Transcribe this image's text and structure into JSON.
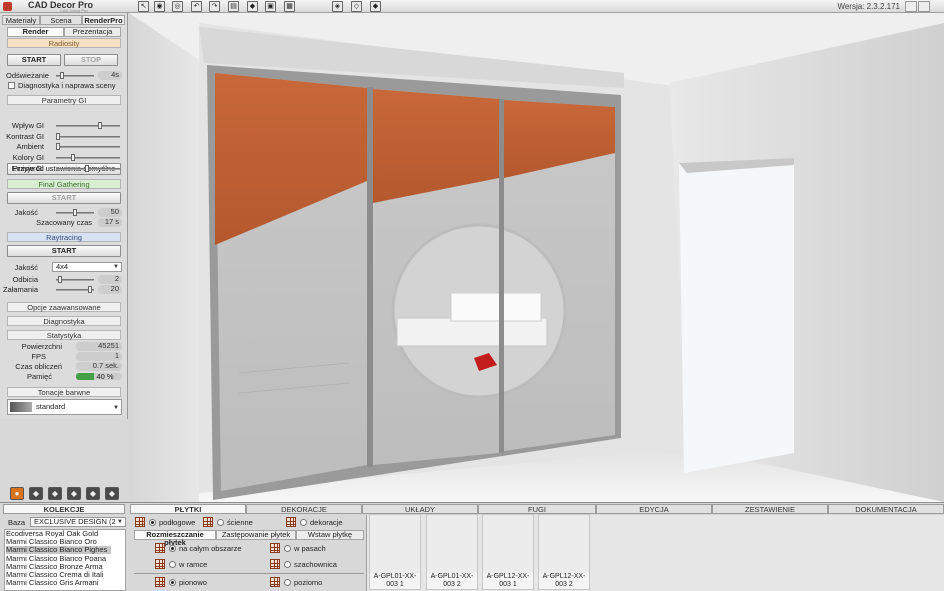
{
  "app": {
    "title": "CAD Decor Pro",
    "subtitle": "CAD Decor Pro",
    "version": "Wersja: 2.3.2.171"
  },
  "left_tabs": [
    "Materiały",
    "Scena",
    "RenderPro"
  ],
  "render_tabs": [
    "Render",
    "Prezentacja"
  ],
  "radiosity": {
    "header": "Radiosity",
    "start": "START",
    "stop": "STOP",
    "refresh_label": "Odświeżanie",
    "refresh_value": "4s",
    "diagnostics": "Diagnostyka i naprawa sceny"
  },
  "gi": {
    "header": "Parametry GI",
    "sliders": [
      {
        "label": "Wpływ GI",
        "pos": 0.72
      },
      {
        "label": "Kontrast GI",
        "pos": 0.0
      },
      {
        "label": "Ambient",
        "pos": 0.0
      },
      {
        "label": "Kolory GI",
        "pos": 0.25
      },
      {
        "label": "Emisje GI",
        "pos": 0.5
      }
    ],
    "reset": "Przywróć ustawienia domyślne"
  },
  "final_gathering": {
    "header": "Final Gathering",
    "start": "START",
    "quality_label": "Jakość",
    "quality_value": "50",
    "quality_pos": 0.5,
    "time_label": "Szacowany czas",
    "time_value": "17 s"
  },
  "raytracing": {
    "header": "Raytracing",
    "start": "START",
    "quality_label": "Jakość",
    "quality_value": "4x4",
    "reflections_label": "Odbicia",
    "reflections_value": "2",
    "reflections_pos": 0.05,
    "refractions_label": "Załamania",
    "refractions_value": "20",
    "refractions_pos": 0.95
  },
  "advanced": "Opcje zaawansowane",
  "diag_header": "Diagnostyka",
  "stats": {
    "header": "Statystyka",
    "rows": [
      {
        "label": "Powierzchni",
        "value": "45251"
      },
      {
        "label": "FPS",
        "value": "1"
      },
      {
        "label": "Czas obliczeń",
        "value": "0.7 sek."
      },
      {
        "label": "Pamięć",
        "value": "40 %"
      }
    ],
    "memory_percent": 40
  },
  "tone": {
    "header": "Tonacje barwne",
    "value": "standard"
  },
  "bottom": {
    "left_tab": "KOLEKCJE",
    "tabs": [
      "PŁYTKI",
      "DEKORACJE",
      "UKŁADY",
      "FUGI",
      "EDYCJA",
      "ZESTAWIENIE",
      "DOKUMENTACJA"
    ],
    "base_label": "Baza",
    "base_value": "EXCLUSIVE DESIGN (2",
    "collections": [
      "Ecodiversa Royal Oak Gold",
      "Marmi Classico Bianco Oro",
      "Marmi Classico Bianco Pighes",
      "Marmi Classico Bianco Poana",
      "Marmi Classico Bronze Arma",
      "Marmi Classico Crema di Itali",
      "Marmi Classico Gris Armani"
    ],
    "selected_collection": 2,
    "surface": [
      "podłogowe",
      "ścienne",
      "dekoracje"
    ],
    "subtabs": [
      "Rozmieszczanie płytek",
      "Zastępowanie płytek",
      "Wstaw płytkę"
    ],
    "placement": {
      "whole": "na całym obszarze",
      "strips": "w pasach",
      "frame": "w ramce",
      "checker": "szachownica",
      "vertical": "pionowo",
      "horizontal": "poziomo"
    },
    "tiles": [
      "A-GPL01-XX-003 1",
      "A-GPL01-XX-003 2",
      "A-GPL12-XX-003 1",
      "A-GPL12-XX-003 2"
    ]
  }
}
